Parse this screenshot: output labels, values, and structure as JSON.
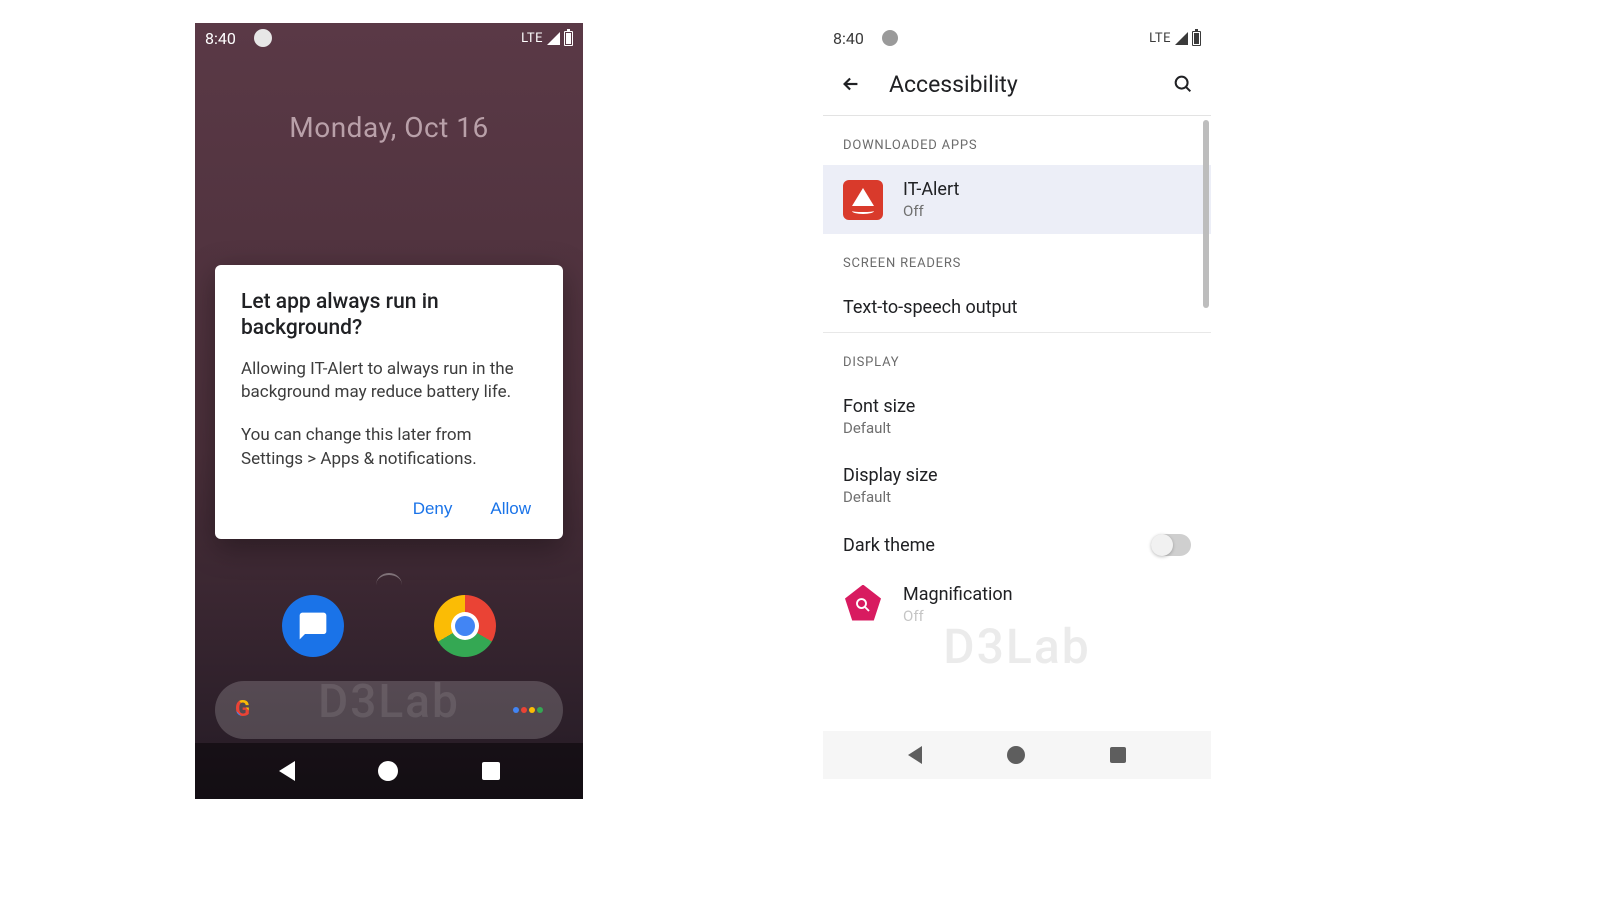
{
  "watermark": "D3Lab",
  "phone1": {
    "statusbar": {
      "time": "8:40",
      "net": "LTE"
    },
    "date": "Monday, Oct 16",
    "dialog": {
      "title": "Let app always run in background?",
      "body1": "Allowing IT-Alert to always run in the background may reduce battery life.",
      "body2": "You can change this later from Settings > Apps & notifications.",
      "deny": "Deny",
      "allow": "Allow"
    }
  },
  "phone2": {
    "statusbar": {
      "time": "8:40",
      "net": "LTE"
    },
    "appbar": {
      "title": "Accessibility"
    },
    "sections": {
      "downloaded": "DOWNLOADED APPS",
      "screenreaders": "SCREEN READERS",
      "display": "DISPLAY"
    },
    "rows": {
      "italert": {
        "title": "IT-Alert",
        "sub": "Off"
      },
      "tts": {
        "title": "Text-to-speech output"
      },
      "fontsize": {
        "title": "Font size",
        "sub": "Default"
      },
      "displaysize": {
        "title": "Display size",
        "sub": "Default"
      },
      "darktheme": {
        "title": "Dark theme"
      },
      "magnification": {
        "title": "Magnification",
        "sub": "Off"
      }
    }
  }
}
